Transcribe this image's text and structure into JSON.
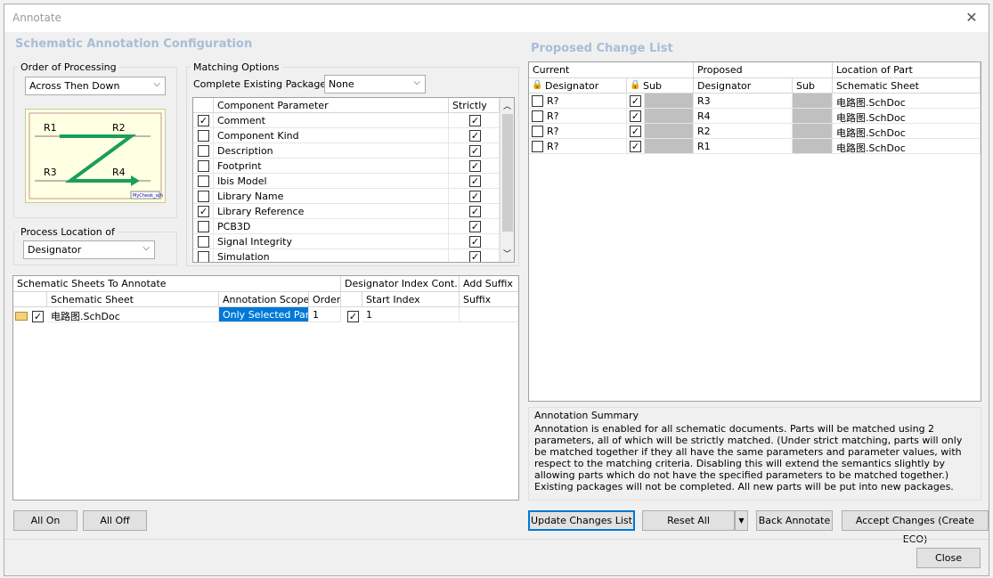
{
  "window": {
    "title": "Annotate"
  },
  "left": {
    "section_title": "Schematic Annotation Configuration",
    "order_group_label": "Order of Processing",
    "order_value": "Across Then Down",
    "diagram_labels": [
      "R1",
      "R2",
      "R3",
      "R4"
    ],
    "diagram_footer": "MyCheok_sch",
    "process_group_label": "Process Location of",
    "process_value": "Designator",
    "matching_group_label": "Matching Options",
    "complete_packages_label": "Complete Existing Packages",
    "complete_packages_value": "None",
    "params_headers": [
      "Component Parameter",
      "Strictly"
    ],
    "params": [
      {
        "label": "Comment",
        "checked": true,
        "strict": true
      },
      {
        "label": "Component Kind",
        "checked": false,
        "strict": true
      },
      {
        "label": "Description",
        "checked": false,
        "strict": true
      },
      {
        "label": "Footprint",
        "checked": false,
        "strict": true
      },
      {
        "label": "Ibis Model",
        "checked": false,
        "strict": true
      },
      {
        "label": "Library Name",
        "checked": false,
        "strict": true
      },
      {
        "label": "Library Reference",
        "checked": true,
        "strict": true
      },
      {
        "label": "PCB3D",
        "checked": false,
        "strict": true
      },
      {
        "label": "Signal Integrity",
        "checked": false,
        "strict": true
      },
      {
        "label": "Simulation",
        "checked": false,
        "strict": true
      }
    ],
    "sheets_header1": "Schematic Sheets To Annotate",
    "sheets_header2": "Designator Index Cont...",
    "sheets_header3": "Add Suffix",
    "sheets_cols": [
      "Schematic Sheet",
      "Annotation Scope",
      "Order",
      "Start Index",
      "Suffix"
    ],
    "sheets_row": {
      "sheet": "电路图.SchDoc",
      "scope": "Only Selected Parts",
      "order": "1",
      "start_index": "1"
    },
    "all_on": "All On",
    "all_off": "All Off"
  },
  "right": {
    "section_title": "Proposed Change List",
    "group_headers": [
      "Current",
      "Proposed",
      "Location of Part"
    ],
    "cols": [
      "Designator",
      "Sub",
      "Designator",
      "Sub",
      "Schematic Sheet"
    ],
    "rows": [
      {
        "current": "R?",
        "proposed": "R3",
        "sheet": "电路图.SchDoc"
      },
      {
        "current": "R?",
        "proposed": "R4",
        "sheet": "电路图.SchDoc"
      },
      {
        "current": "R?",
        "proposed": "R2",
        "sheet": "电路图.SchDoc"
      },
      {
        "current": "R?",
        "proposed": "R1",
        "sheet": "电路图.SchDoc"
      }
    ],
    "summary_title": "Annotation Summary",
    "summary_text": "Annotation is enabled for all schematic documents. Parts will be matched using 2 parameters, all of which will be strictly matched. (Under strict matching, parts will only be matched together if they all have the same parameters and parameter values, with respect to the matching criteria. Disabling this will extend the semantics slightly by allowing parts which do not have the specified parameters to be matched together.) Existing packages will not be completed. All new parts will be put into new packages.",
    "update_btn": "Update Changes List",
    "reset_btn": "Reset All",
    "back_btn": "Back Annotate",
    "accept_btn": "Accept Changes (Create ECO)"
  },
  "footer": {
    "close_btn": "Close"
  },
  "colors": {
    "accent": "#0078d7",
    "header": "#a7bed6",
    "selected": "#0078d7",
    "diagram_bg": "#ffffe1",
    "diagram_line": "#1a9e5a"
  }
}
